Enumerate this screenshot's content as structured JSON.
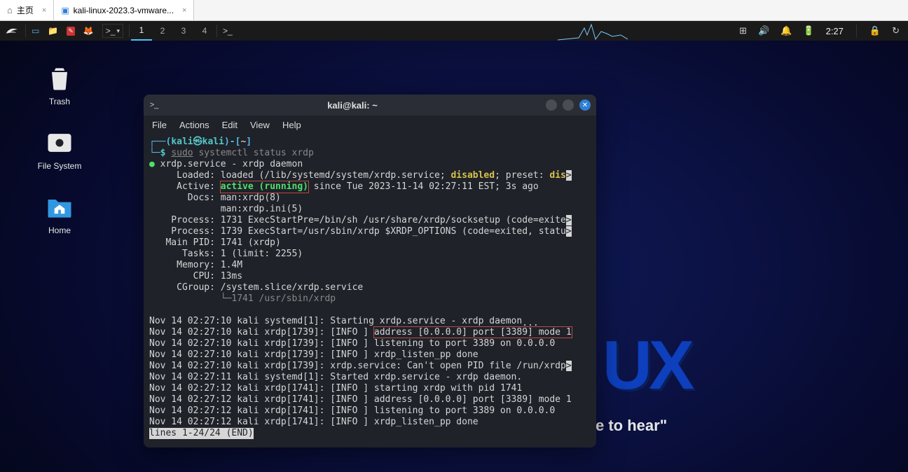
{
  "host_tabs": {
    "home_label": "主页",
    "vm_label": "kali-linux-2023.3-vmware...",
    "close_x": "×"
  },
  "panel": {
    "workspaces": [
      "1",
      "2",
      "3",
      "4"
    ],
    "active_workspace": 0,
    "clock": "2:27",
    "tray": {
      "workspace_overview": "⊞",
      "volume": "🔊",
      "notifications": "🔔",
      "battery": "🔋",
      "lock": "🔒",
      "power": "↻"
    }
  },
  "desktop_icons": {
    "trash": "Trash",
    "filesystem": "File System",
    "home": "Home"
  },
  "wallpaper": {
    "slogan": "e to hear\"",
    "big_letters": "UX"
  },
  "terminal": {
    "title": "kali@kali: ~",
    "menu": {
      "file": "File",
      "actions": "Actions",
      "edit": "Edit",
      "view": "View",
      "help": "Help"
    },
    "prompt": {
      "open_paren": "┌──(",
      "user": "kali",
      "at": "㉿",
      "host": "kali",
      "close_paren": ")-[",
      "cwd": "~",
      "close_bracket": "]",
      "line2_prefix": "└─",
      "dollar": "$ ",
      "cmd_sudo": "sudo",
      "cmd_rest": " systemctl status xrdp"
    },
    "status": {
      "line_service": "xrdp.service - xrdp daemon",
      "loaded_label": "     Loaded: loaded (/lib/systemd/system/xrdp.service; ",
      "disabled": "disabled",
      "preset_prefix": "; preset: ",
      "preset_dis": "dis",
      "active_label": "     Active: ",
      "active_value": "active (running)",
      "active_since": " since Tue 2023-11-14 02:27:11 EST; 3s ago",
      "docs1": "       Docs: man:xrdp(8)",
      "docs2": "             man:xrdp.ini(5)",
      "proc1": "    Process: 1731 ExecStartPre=/bin/sh /usr/share/xrdp/socksetup (code=exite",
      "proc2": "    Process: 1739 ExecStart=/usr/sbin/xrdp $XRDP_OPTIONS (code=exited, statu",
      "mainpid": "   Main PID: 1741 (xrdp)",
      "tasks": "      Tasks: 1 (limit: 2255)",
      "memory": "     Memory: 1.4M",
      "cpu": "        CPU: 13ms",
      "cgroup": "     CGroup: /system.slice/xrdp.service",
      "cgroup_child": "             └─1741 /usr/sbin/xrdp"
    },
    "journal": {
      "l1_a": "Nov 14 02:27:10 kali systemd[1]: Starting xrdp.service - xrdp daemon",
      "l1_b": "...",
      "l2_a": "Nov 14 02:27:10 kali xrdp[1739]: [INFO ] ",
      "l2_b": "address [0.0.0.0] port [3389] mode 1",
      "l3": "Nov 14 02:27:10 kali xrdp[1739]: [INFO ] listening to port 3389 on 0.0.0.0",
      "l4": "Nov 14 02:27:10 kali xrdp[1739]: [INFO ] xrdp_listen_pp done",
      "l5": "Nov 14 02:27:10 kali xrdp[1739]: xrdp.service: Can't open PID file /run/xrdp",
      "l6": "Nov 14 02:27:11 kali systemd[1]: Started xrdp.service - xrdp daemon.",
      "l7": "Nov 14 02:27:12 kali xrdp[1741]: [INFO ] starting xrdp with pid 1741",
      "l8": "Nov 14 02:27:12 kali xrdp[1741]: [INFO ] address [0.0.0.0] port [3389] mode 1",
      "l9": "Nov 14 02:27:12 kali xrdp[1741]: [INFO ] listening to port 3389 on 0.0.0.0",
      "l10": "Nov 14 02:27:12 kali xrdp[1741]: [INFO ] xrdp_listen_pp done"
    },
    "pager_status": "lines 1-24/24 (END)"
  },
  "colors": {
    "highlight_box": "#b94a48",
    "accent_blue": "#2e7fd4"
  }
}
